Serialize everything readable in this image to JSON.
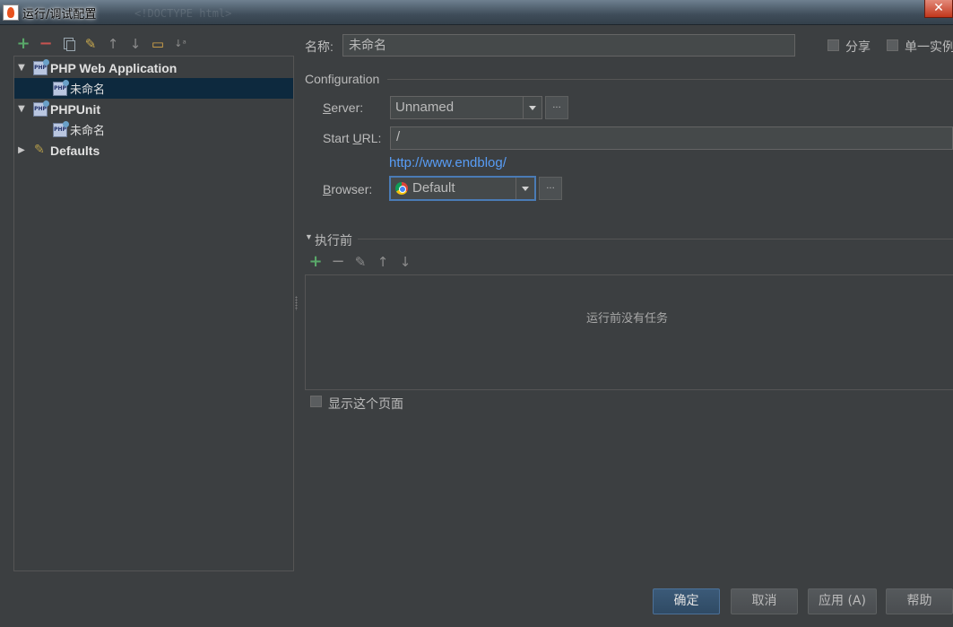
{
  "window": {
    "title": "运行/调试配置",
    "background_text": "<!DOCTYPE html>"
  },
  "tree": {
    "items": [
      {
        "label": "PHP Web Application",
        "expanded": true
      },
      {
        "label": "未命名",
        "selected": true
      },
      {
        "label": "PHPUnit",
        "expanded": true
      },
      {
        "label": "未命名"
      },
      {
        "label": "Defaults",
        "expanded": false
      }
    ]
  },
  "form": {
    "name_label": "名称:",
    "name_value": "未命名",
    "share_label": "分享",
    "single_instance_label": "单一实例",
    "configuration_title": "Configuration",
    "server_label": "Server:",
    "server_value": "Unnamed",
    "start_url_label": "Start URL:",
    "start_url_value": "/",
    "url_hint": "http://www.endblog/",
    "browser_label": "Browser:",
    "browser_value": "Default",
    "ellipsis": "...",
    "before_launch_title": "执行前",
    "empty_tasks_text": "运行前没有任务",
    "show_page_label": "显示这个页面"
  },
  "buttons": {
    "ok": "确定",
    "cancel": "取消",
    "apply": "应用 (A)",
    "help": "帮助"
  },
  "colors": {
    "background": "#3c3f41",
    "selection": "#0d293e",
    "link": "#589df6",
    "add": "#59a869",
    "remove": "#c75450"
  }
}
